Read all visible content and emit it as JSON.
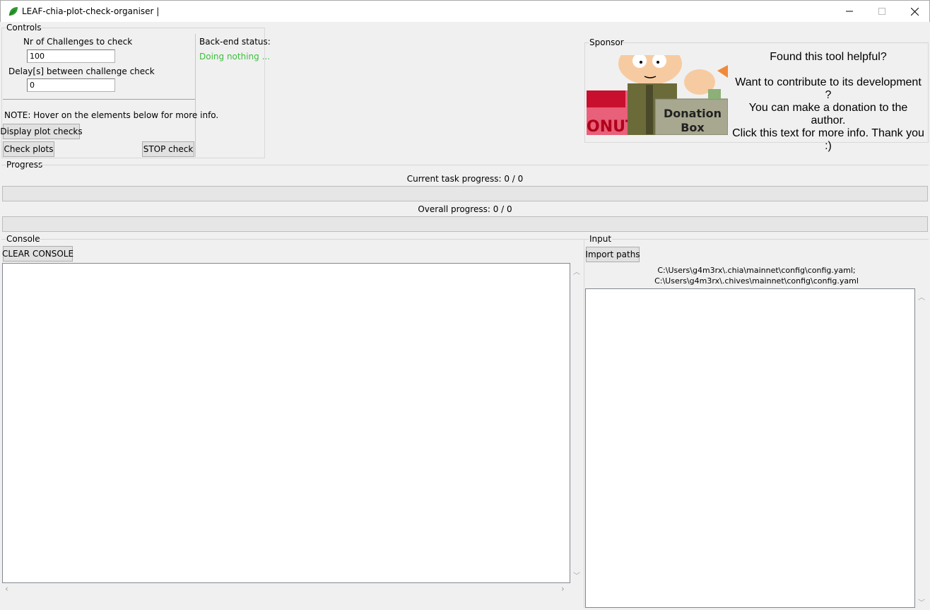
{
  "window": {
    "title": "LEAF-chia-plot-check-organiser |",
    "minimize": "—",
    "maximize": "☐",
    "close": "✕"
  },
  "controls": {
    "label": "Controls",
    "challenges_label": "Nr of Challenges to check",
    "challenges_value": "100",
    "delay_label": "Delay[s] between challenge check",
    "delay_value": "0",
    "note": "NOTE: Hover on the elements below for more info.",
    "display_button": "Display plot checks",
    "check_button": "Check plots",
    "stop_button": "STOP check",
    "backend_label": "Back-end status:",
    "backend_status": "Doing nothing ...",
    "status_color": "#3cbf3c"
  },
  "sponsor": {
    "label": "Sponsor",
    "line1": "Found this tool helpful?",
    "line2": "Want to contribute to its development ?",
    "line3": "You can make a donation to the author.",
    "line4": "Click this text for more info. Thank you :)",
    "image_text_box": "Donation\nBox",
    "image_text_donuts": "ONUTS"
  },
  "progress": {
    "label": "Progress",
    "current_task": "Current task progress: 0 / 0",
    "current_fraction": 0,
    "overall": "Overall progress: 0 / 0",
    "overall_fraction": 0
  },
  "console": {
    "label": "Console",
    "clear_button": "CLEAR CONSOLE"
  },
  "input": {
    "label": "Input",
    "import_button": "Import paths",
    "path1": "C:\\Users\\g4m3rx\\.chia\\mainnet\\config\\config.yaml;",
    "path2": "C:\\Users\\g4m3rx\\.chives\\mainnet\\config\\config.yaml"
  }
}
